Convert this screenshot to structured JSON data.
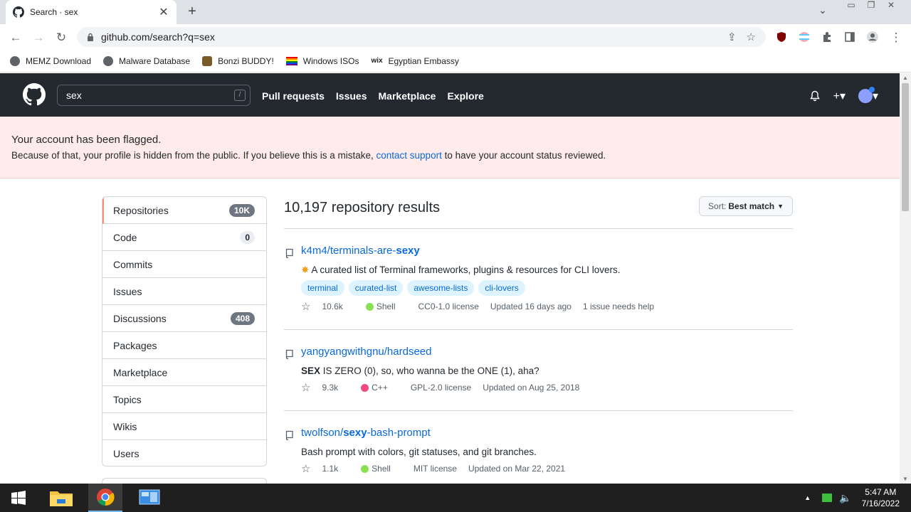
{
  "browser": {
    "tab_title": "Search · sex",
    "url": "github.com/search?q=sex",
    "bookmarks": [
      {
        "label": "MEMZ Download"
      },
      {
        "label": "Malware Database"
      },
      {
        "label": "Bonzi BUDDY!"
      },
      {
        "label": "Windows ISOs"
      },
      {
        "label": "Egyptian Embassy"
      }
    ]
  },
  "gh": {
    "search_value": "sex",
    "search_key": "/",
    "nav": [
      "Pull requests",
      "Issues",
      "Marketplace",
      "Explore"
    ]
  },
  "banner": {
    "title": "Your account has been flagged.",
    "text_before": "Because of that, your profile is hidden from the public. If you believe this is a mistake, ",
    "link": "contact support",
    "text_after": " to have your account status reviewed."
  },
  "sidebar": {
    "items": [
      {
        "label": "Repositories",
        "count": "10K"
      },
      {
        "label": "Code",
        "count": "0"
      },
      {
        "label": "Commits",
        "count": ""
      },
      {
        "label": "Issues",
        "count": ""
      },
      {
        "label": "Discussions",
        "count": "408"
      },
      {
        "label": "Packages",
        "count": ""
      },
      {
        "label": "Marketplace",
        "count": ""
      },
      {
        "label": "Topics",
        "count": ""
      },
      {
        "label": "Wikis",
        "count": ""
      },
      {
        "label": "Users",
        "count": ""
      }
    ]
  },
  "results": {
    "title": "10,197 repository results",
    "sort_label": "Sort:",
    "sort_value": "Best match",
    "repos": [
      {
        "owner": "k4m4/terminals-are-",
        "match": "sexy",
        "description": "A curated list of Terminal frameworks, plugins & resources for CLI lovers.",
        "topics": [
          "terminal",
          "curated-list",
          "awesome-lists",
          "cli-lovers"
        ],
        "stars": "10.6k",
        "language": "Shell",
        "lang_color": "#89e051",
        "license": "CC0-1.0 license",
        "updated": "Updated 16 days ago",
        "extra": "1 issue needs help"
      },
      {
        "owner": "yangyangwithgnu/hardseed",
        "match": "",
        "desc_match": "SEX",
        "description": " IS ZERO (0), so, who wanna be the ONE (1), aha?",
        "stars": "9.3k",
        "language": "C++",
        "lang_color": "#f34b7d",
        "license": "GPL-2.0 license",
        "updated": "Updated on Aug 25, 2018"
      },
      {
        "owner": "twolfson/",
        "match": "sexy",
        "suffix": "-bash-prompt",
        "description": "Bash prompt with colors, git statuses, and git branches.",
        "stars": "1.1k",
        "language": "Shell",
        "lang_color": "#89e051",
        "license": "MIT license",
        "updated": "Updated on Mar 22, 2021"
      }
    ]
  },
  "taskbar": {
    "time": "5:47 AM",
    "date": "7/16/2022"
  }
}
